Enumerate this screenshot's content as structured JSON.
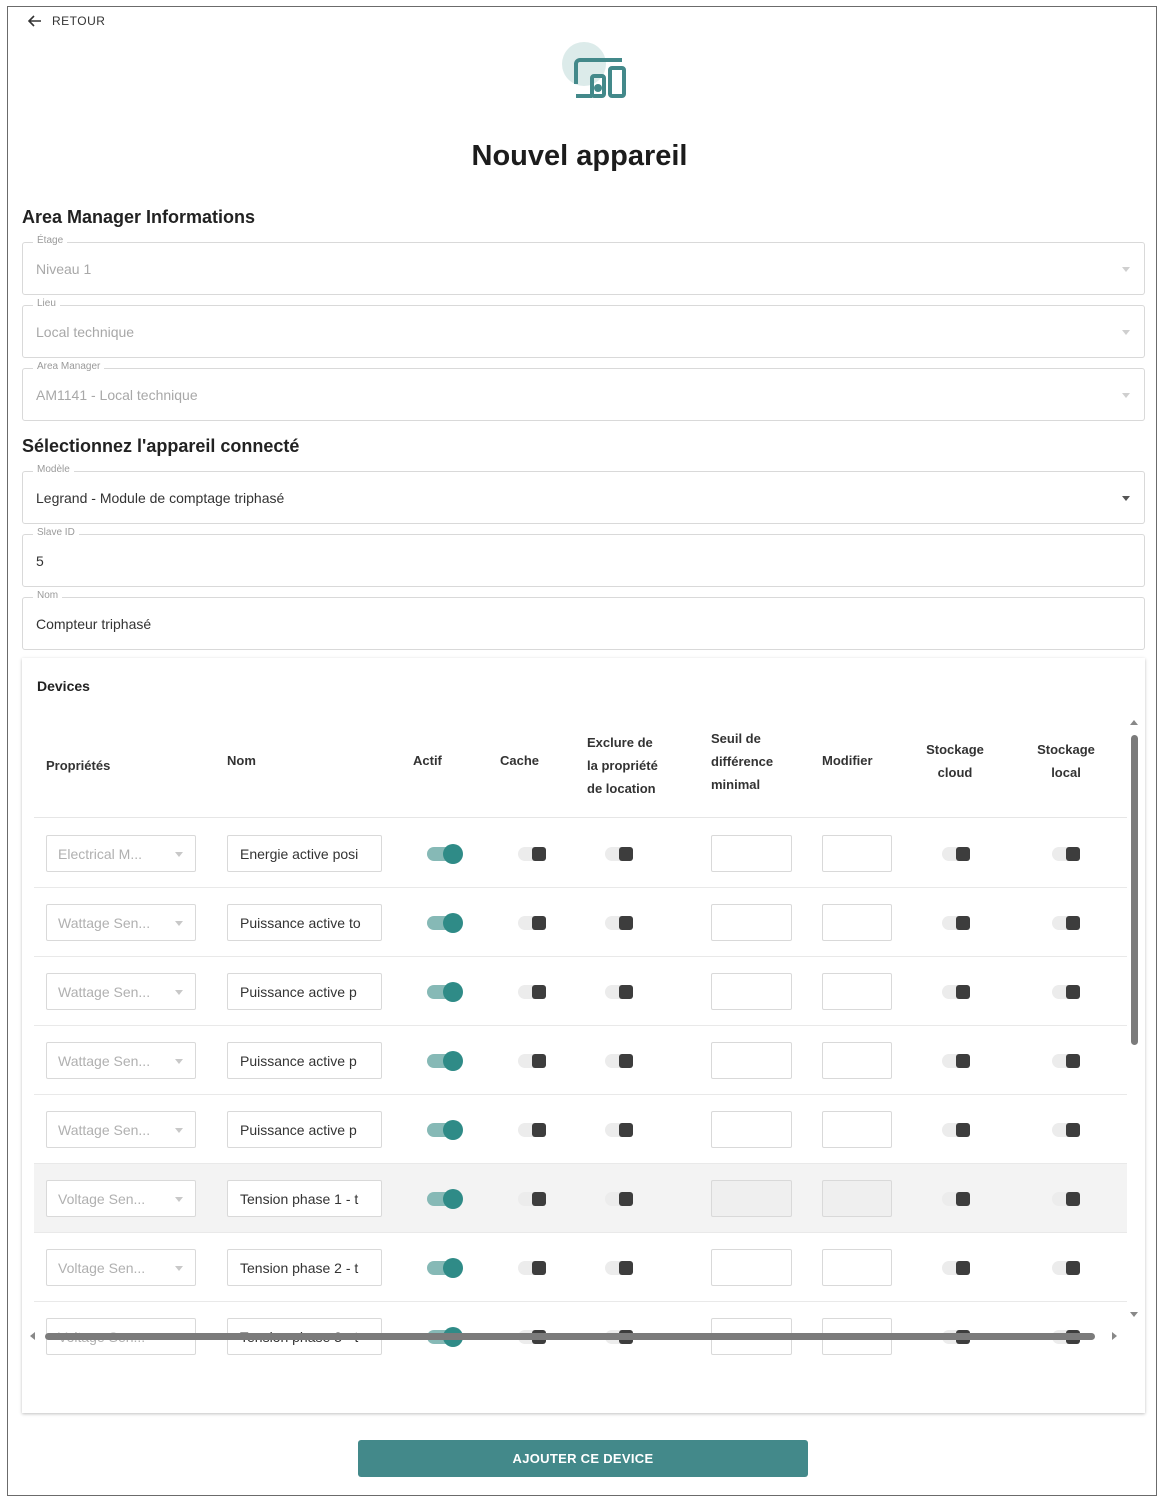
{
  "nav": {
    "back_label": "RETOUR"
  },
  "header": {
    "title": "Nouvel appareil",
    "icon": "devices-icon",
    "accent": "#43898a"
  },
  "area_section": {
    "title": "Area Manager Informations",
    "fields": [
      {
        "label": "Étage",
        "value": "Niveau 1"
      },
      {
        "label": "Lieu",
        "value": "Local technique"
      },
      {
        "label": "Area Manager",
        "value": "AM1141 - Local technique"
      }
    ]
  },
  "device_section": {
    "title": "Sélectionnez l'appareil connecté",
    "model": {
      "label": "Modèle",
      "value": "Legrand - Module de comptage triphasé"
    },
    "slave_id": {
      "label": "Slave ID",
      "value": "5"
    },
    "name": {
      "label": "Nom",
      "value": "Compteur triphasé"
    }
  },
  "devices": {
    "title": "Devices",
    "columns": [
      "Propriétés",
      "Nom",
      "Actif",
      "Cache",
      "Exclure de la propriété de location",
      "Seuil de différence minimal",
      "Modifier",
      "Stockage cloud",
      "Stockage local"
    ],
    "column_lines": {
      "exclude": [
        "Exclure de",
        "la propriété",
        "de location"
      ],
      "seuil": [
        "Seuil de",
        "différence",
        "minimal"
      ],
      "cloud": [
        "Stockage",
        "cloud"
      ],
      "local": [
        "Stockage",
        "local"
      ]
    },
    "rows": [
      {
        "property": "Electrical M...",
        "name": "Energie active posi",
        "active": true,
        "cache": false,
        "exclude": false,
        "cloud": false,
        "local": false
      },
      {
        "property": "Wattage Sen...",
        "name": "Puissance active to",
        "active": true,
        "cache": false,
        "exclude": false,
        "cloud": false,
        "local": false
      },
      {
        "property": "Wattage Sen...",
        "name": "Puissance active p",
        "active": true,
        "cache": false,
        "exclude": false,
        "cloud": false,
        "local": false
      },
      {
        "property": "Wattage Sen...",
        "name": "Puissance active p",
        "active": true,
        "cache": false,
        "exclude": false,
        "cloud": false,
        "local": false
      },
      {
        "property": "Wattage Sen...",
        "name": "Puissance active p",
        "active": true,
        "cache": false,
        "exclude": false,
        "cloud": false,
        "local": false
      },
      {
        "property": "Voltage Sen...",
        "name": "Tension phase 1 - t",
        "active": true,
        "cache": false,
        "exclude": false,
        "cloud": false,
        "local": false,
        "highlighted": true
      },
      {
        "property": "Voltage Sen...",
        "name": "Tension phase 2 - t",
        "active": true,
        "cache": false,
        "exclude": false,
        "cloud": false,
        "local": false
      },
      {
        "property": "Voltage Sen...",
        "name": "Tension phase 3 - t",
        "active": true,
        "cache": false,
        "exclude": false,
        "cloud": false,
        "local": false
      }
    ]
  },
  "actions": {
    "submit_label": "AJOUTER CE DEVICE"
  }
}
